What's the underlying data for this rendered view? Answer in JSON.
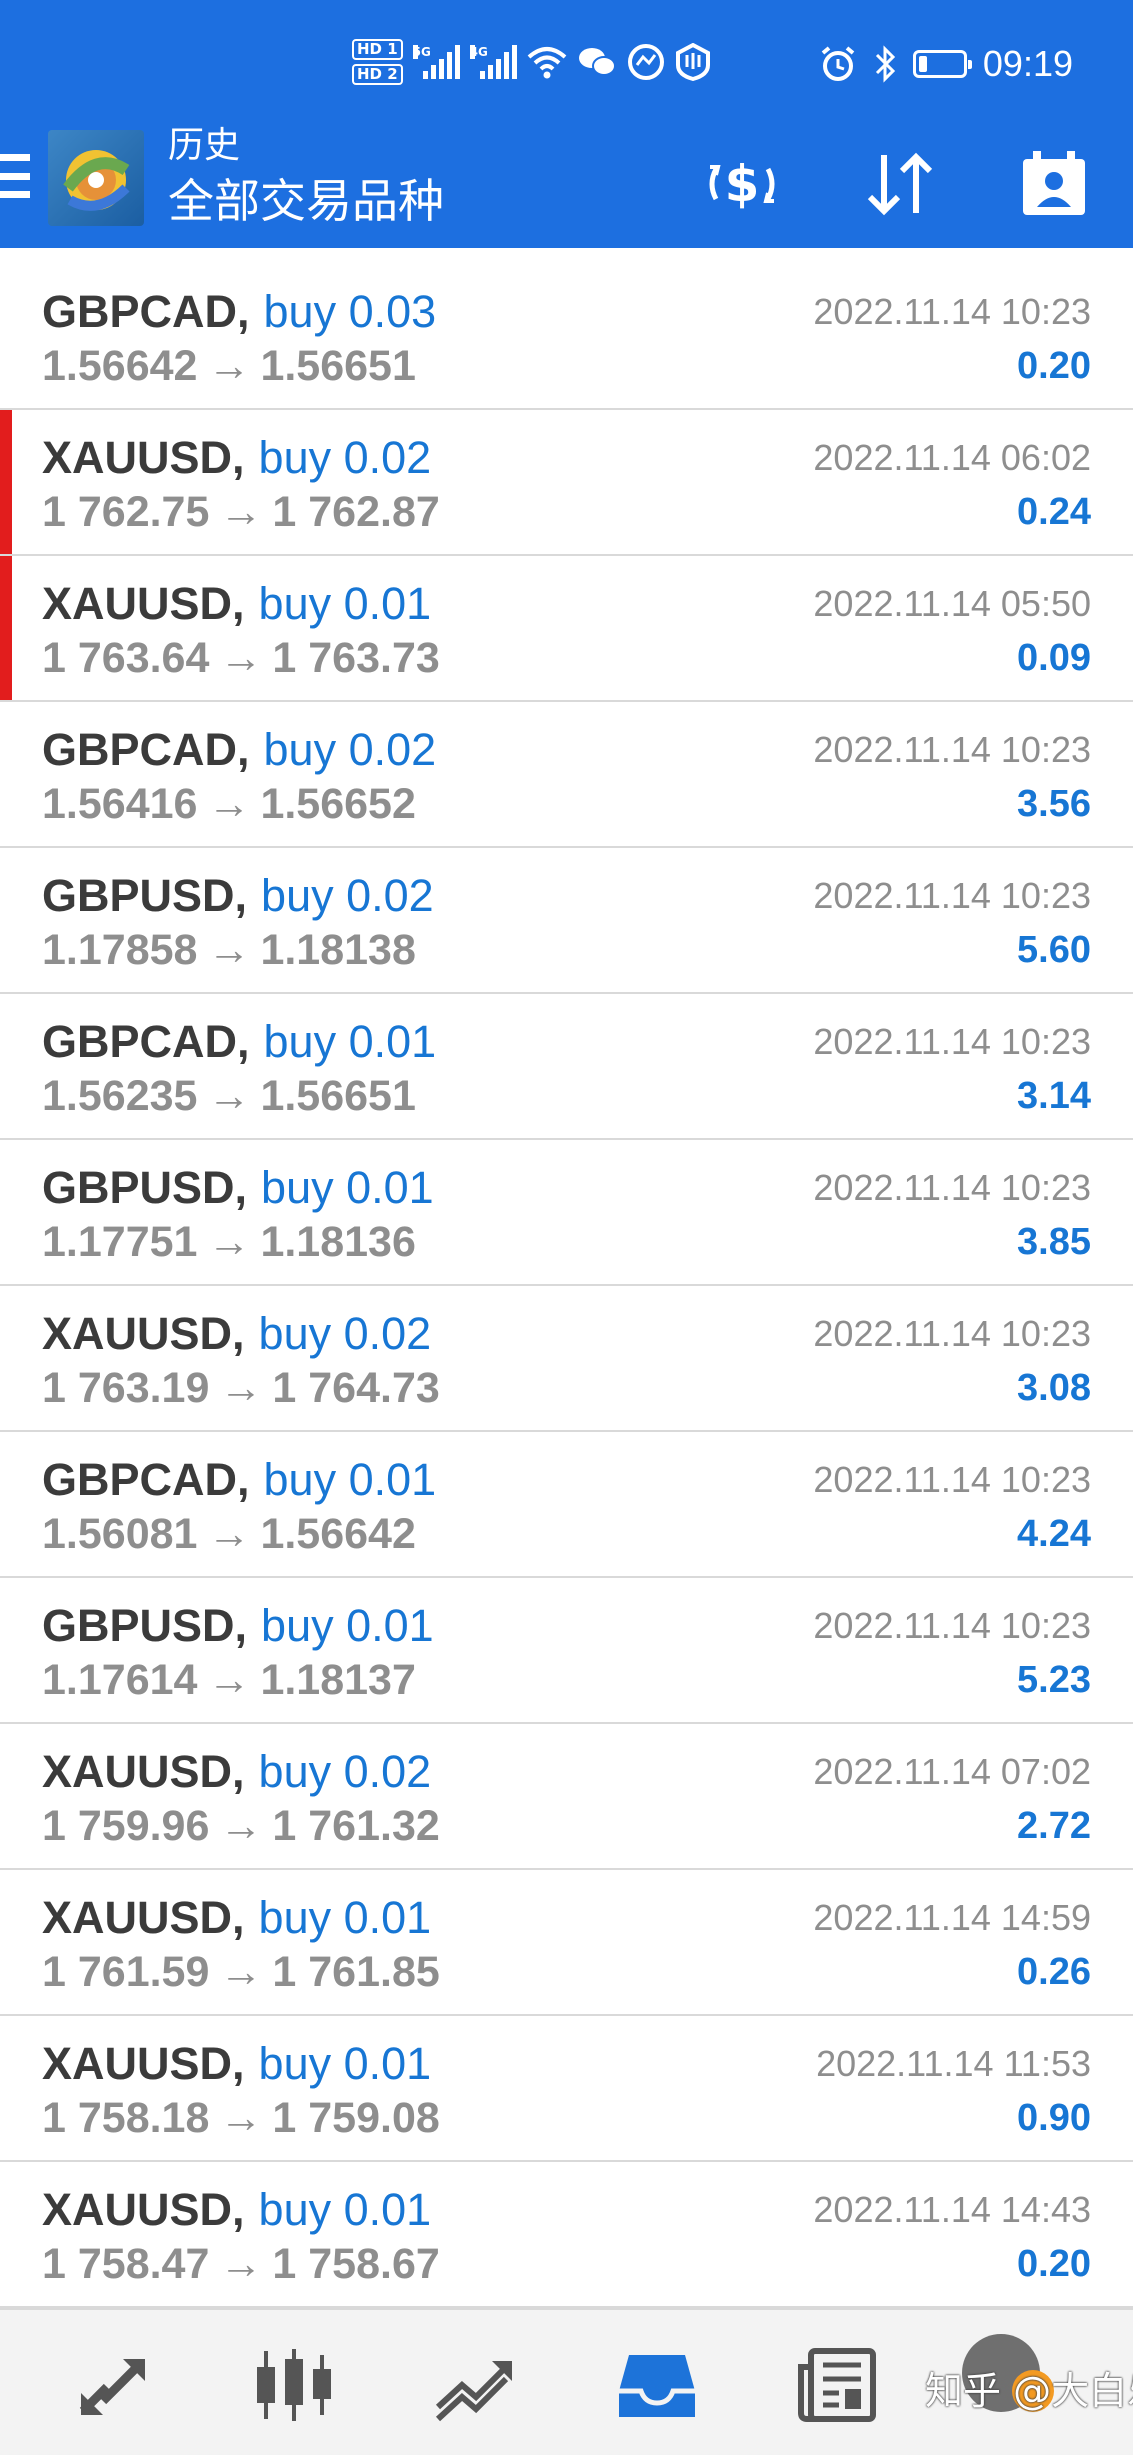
{
  "status_bar": {
    "hd1": "HD 1",
    "hd2": "HD 2",
    "net1": "5G",
    "net2": "4G",
    "time": "09:19"
  },
  "app_bar": {
    "title": "历史",
    "subtitle": "全部交易品种"
  },
  "trades": [
    {
      "symbol": "GBPCAD",
      "side": "buy 0.03",
      "open": "1.56642",
      "close": "1.56651",
      "time": "2022.11.14 10:23",
      "profit": "0.20",
      "marked": false
    },
    {
      "symbol": "XAUUSD",
      "side": "buy 0.02",
      "open": "1 762.75",
      "close": "1 762.87",
      "time": "2022.11.14 06:02",
      "profit": "0.24",
      "marked": true
    },
    {
      "symbol": "XAUUSD",
      "side": "buy 0.01",
      "open": "1 763.64",
      "close": "1 763.73",
      "time": "2022.11.14 05:50",
      "profit": "0.09",
      "marked": true
    },
    {
      "symbol": "GBPCAD",
      "side": "buy 0.02",
      "open": "1.56416",
      "close": "1.56652",
      "time": "2022.11.14 10:23",
      "profit": "3.56",
      "marked": false
    },
    {
      "symbol": "GBPUSD",
      "side": "buy 0.02",
      "open": "1.17858",
      "close": "1.18138",
      "time": "2022.11.14 10:23",
      "profit": "5.60",
      "marked": false
    },
    {
      "symbol": "GBPCAD",
      "side": "buy 0.01",
      "open": "1.56235",
      "close": "1.56651",
      "time": "2022.11.14 10:23",
      "profit": "3.14",
      "marked": false
    },
    {
      "symbol": "GBPUSD",
      "side": "buy 0.01",
      "open": "1.17751",
      "close": "1.18136",
      "time": "2022.11.14 10:23",
      "profit": "3.85",
      "marked": false
    },
    {
      "symbol": "XAUUSD",
      "side": "buy 0.02",
      "open": "1 763.19",
      "close": "1 764.73",
      "time": "2022.11.14 10:23",
      "profit": "3.08",
      "marked": false
    },
    {
      "symbol": "GBPCAD",
      "side": "buy 0.01",
      "open": "1.56081",
      "close": "1.56642",
      "time": "2022.11.14 10:23",
      "profit": "4.24",
      "marked": false
    },
    {
      "symbol": "GBPUSD",
      "side": "buy 0.01",
      "open": "1.17614",
      "close": "1.18137",
      "time": "2022.11.14 10:23",
      "profit": "5.23",
      "marked": false
    },
    {
      "symbol": "XAUUSD",
      "side": "buy 0.02",
      "open": "1 759.96",
      "close": "1 761.32",
      "time": "2022.11.14 07:02",
      "profit": "2.72",
      "marked": false
    },
    {
      "symbol": "XAUUSD",
      "side": "buy 0.01",
      "open": "1 761.59",
      "close": "1 761.85",
      "time": "2022.11.14 14:59",
      "profit": "0.26",
      "marked": false
    },
    {
      "symbol": "XAUUSD",
      "side": "buy 0.01",
      "open": "1 758.18",
      "close": "1 759.08",
      "time": "2022.11.14 11:53",
      "profit": "0.90",
      "marked": false
    },
    {
      "symbol": "XAUUSD",
      "side": "buy 0.01",
      "open": "1 758.47",
      "close": "1 758.67",
      "time": "2022.11.14 14:43",
      "profit": "0.20",
      "marked": false
    }
  ],
  "arrow": "→",
  "bottom_nav": {
    "items": [
      "quotes-icon",
      "chart-icon",
      "trade-icon",
      "history-icon",
      "news-icon",
      "settings-icon"
    ]
  },
  "watermark": "知乎 @大白乐",
  "colors": {
    "header_bg": "#1d6fe0",
    "accent_blue": "#1776d4",
    "symbol_text": "#3b3b3b",
    "muted_text": "#8e8e8e",
    "marker_red": "#e21d1d"
  }
}
